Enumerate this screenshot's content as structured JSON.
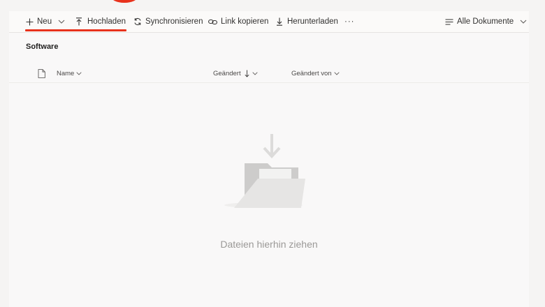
{
  "toolbar": {
    "new_label": "Neu",
    "upload_label": "Hochladen",
    "sync_label": "Synchronisieren",
    "copy_link_label": "Link kopieren",
    "download_label": "Herunterladen",
    "more_label": "···",
    "view_label": "Alle Dokumente",
    "icons": [
      "plus-icon",
      "chevron-down-icon",
      "upload-icon",
      "sync-icon",
      "link-icon",
      "download-icon",
      "more-icon",
      "view-list-icon"
    ]
  },
  "library": {
    "title": "Software"
  },
  "columns": {
    "file_type_icon": "file-icon",
    "name": "Name",
    "modified": "Geändert",
    "modified_by": "Geändert von"
  },
  "empty_state": {
    "message": "Dateien hierhin ziehen",
    "illustration": "folder-drop-icon"
  },
  "colors": {
    "accent_underline": "#e8321c",
    "empty_text": "#9b9997"
  }
}
